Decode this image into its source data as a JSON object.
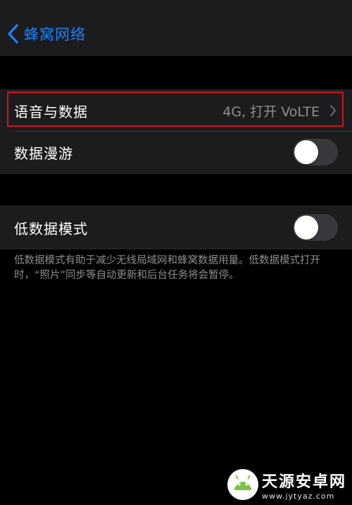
{
  "navbar": {
    "back_label": "蜂窝网络"
  },
  "group1": {
    "voice_data": {
      "label": "语音与数据",
      "value": "4G, 打开 VoLTE"
    },
    "roaming": {
      "label": "数据漫游",
      "enabled": false
    }
  },
  "group2": {
    "low_data": {
      "label": "低数据模式",
      "enabled": false
    },
    "footer": "低数据模式有助于减少无线局域网和蜂窝数据用量。低数据模式打开时，“照片”同步等自动更新和后台任务将会暂停。"
  },
  "watermark": {
    "title": "天源安卓网",
    "url": "www.jytyaz.com"
  },
  "colors": {
    "accent": "#1a82fb",
    "highlight": "#d0141c",
    "cell": "#1c1c1e",
    "secondary_text": "#8e8e93"
  }
}
